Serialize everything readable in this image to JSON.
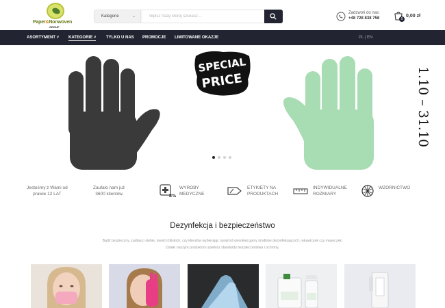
{
  "header": {
    "logo": {
      "word_left": "Paper",
      "word_amp": "&",
      "word_right": "Nonwoven",
      "sub": "GROUP"
    },
    "search": {
      "category_label": "Kategorie",
      "placeholder": "Wpisz frazę której szukasz ..."
    },
    "phone": {
      "label": "Zadzwoń do nas:",
      "number": "+48 728 838 758"
    },
    "cart": {
      "count": "0",
      "total": "0,00 zł"
    }
  },
  "nav": {
    "items": [
      {
        "label": "ASORTYMENT ˅"
      },
      {
        "label": "KATEGORIE ˅"
      },
      {
        "label": "TYLKO U NAS"
      },
      {
        "label": "PROMOCJE"
      },
      {
        "label": "LIMITOWANE OKAZJE"
      }
    ],
    "lang": {
      "pl": "PL",
      "sep": "|",
      "en": "EN"
    }
  },
  "hero": {
    "badge_line1": "SPECIAL",
    "badge_line2": "PRICE",
    "date": "1.10 – 31.10",
    "slides": 4,
    "active_slide": 1
  },
  "features": [
    {
      "lines": [
        "Jesteśmy z Wami od",
        "prawie 12 LAT"
      ],
      "icon": ""
    },
    {
      "lines": [
        "Zaufało nam już",
        "3600 klientów"
      ],
      "icon": ""
    },
    {
      "lines": [
        "WYROBY",
        "MEDYCZNE"
      ],
      "icon": "medical-box-icon",
      "icon_text": "8%"
    },
    {
      "lines": [
        "ETYKIETY NA",
        "PRODUKTACH"
      ],
      "icon": "label-tag-icon"
    },
    {
      "lines": [
        "INDYWIDUALNE",
        "ROZMIARY"
      ],
      "icon": "ruler-icon"
    },
    {
      "lines": [
        "WZORNICTWO"
      ],
      "icon": "pattern-icon"
    }
  ],
  "section": {
    "title": "Dezynfekcja i bezpieczeństwo",
    "desc_line1": "Bądź bezpieczny, zadbaj o siebie, swoich bliskich, czy klientów wybierając spośród szerokiej gamy środków dezynfekujących, rękawiczek czy maseczek.",
    "desc_line2": "Dzięki naszym produktom spełnisz standardy bezpieczeństwa i ochrony."
  },
  "products": [
    {
      "name": "mask-product-card",
      "icon": "face-mask-image"
    },
    {
      "name": "gloves-product-card",
      "icon": "pink-gloves-image"
    },
    {
      "name": "blue-gloves-product-card",
      "icon": "blue-gloves-image"
    },
    {
      "name": "disinfectant-product-card",
      "icon": "disinfectant-bottles-image"
    },
    {
      "name": "dispenser-product-card",
      "icon": "dispenser-image"
    }
  ],
  "colors": {
    "nav_bg": "#222431",
    "accent_dark": "#222431",
    "glove_black": "#3a3a3a",
    "glove_green": "#a8dcb3",
    "mask_pink": "#f4a9bf",
    "glove_pink": "#e83e85",
    "glove_blue": "#8fc3e6"
  }
}
